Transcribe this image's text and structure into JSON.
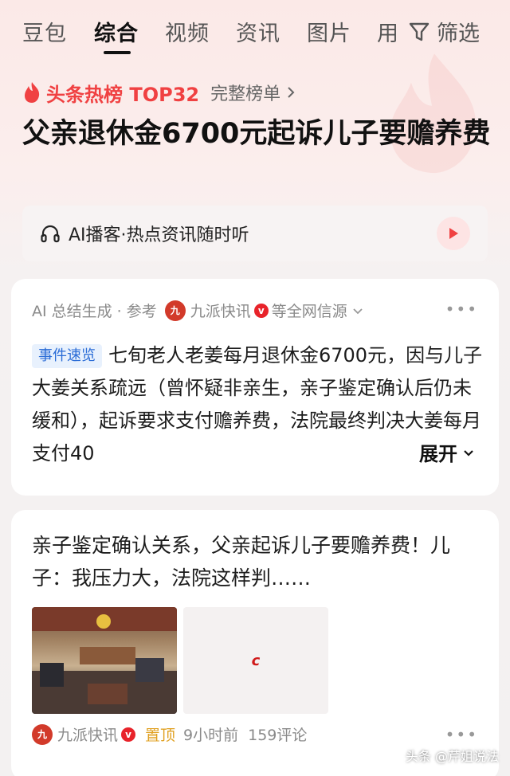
{
  "tabs": [
    "豆包",
    "综合",
    "视频",
    "资讯",
    "图片",
    "用"
  ],
  "active_tab": "综合",
  "filter_label": "筛选",
  "hot": {
    "title": "头条热榜 TOP32",
    "link": "完整榜单",
    "headline": "父亲退休金6700元起诉儿子要赡养费"
  },
  "podcast": {
    "label": "AI播客·热点资讯随时听"
  },
  "ai_card": {
    "generated": "AI 总结生成",
    "ref": "· 参考",
    "source": "九派快讯",
    "source_suffix": "等全网信源",
    "tag": "事件速览",
    "summary": "七旬老人老姜每月退休金6700元，因与儿子大姜关系疏远（曾怀疑非亲生，亲子鉴定确认后仍未缓和），起诉要求支付赡养费，法院最终判决大姜每月支付40",
    "expand": "展开"
  },
  "article": {
    "title": "亲子鉴定确认关系，父亲起诉儿子要赡养费！儿子：我压力大，法院这样判……",
    "source": "九派快讯",
    "pinned": "置顶",
    "time": "9小时前",
    "comments": "159评论"
  },
  "icons": {
    "flame": "flame-icon",
    "headphones": "headphones-icon",
    "play": "play-icon",
    "filter": "filter-icon"
  },
  "colors": {
    "accent_red": "#f04142",
    "tag_blue": "#2a6cd6",
    "pin_gold": "#e0a020"
  },
  "watermark": "头条 @芹姐说法"
}
